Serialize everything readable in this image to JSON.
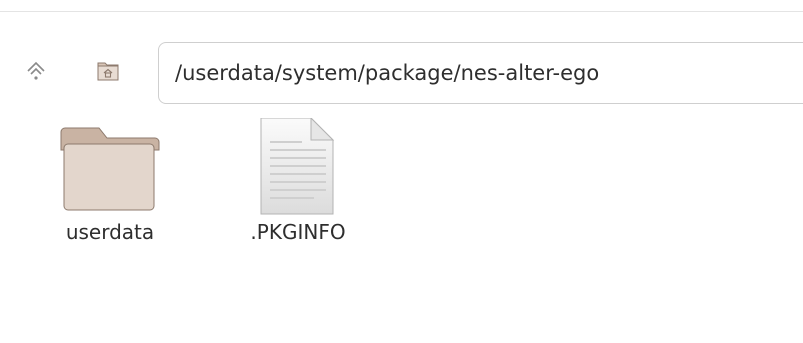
{
  "toolbar": {
    "path": "/userdata/system/package/nes-alter-ego",
    "up_icon": "parent-folder-icon",
    "home_icon": "home-folder-icon"
  },
  "files": [
    {
      "name": "userdata",
      "type": "folder",
      "icon": "folder-icon"
    },
    {
      "name": ".PKGINFO",
      "type": "file",
      "icon": "text-file-icon"
    }
  ],
  "colors": {
    "folder_front": "#e3d6cc",
    "folder_back": "#c9b3a3",
    "folder_outline": "#8d7a6d",
    "path_border": "#cfcfcf",
    "text": "#2e2e2e"
  }
}
